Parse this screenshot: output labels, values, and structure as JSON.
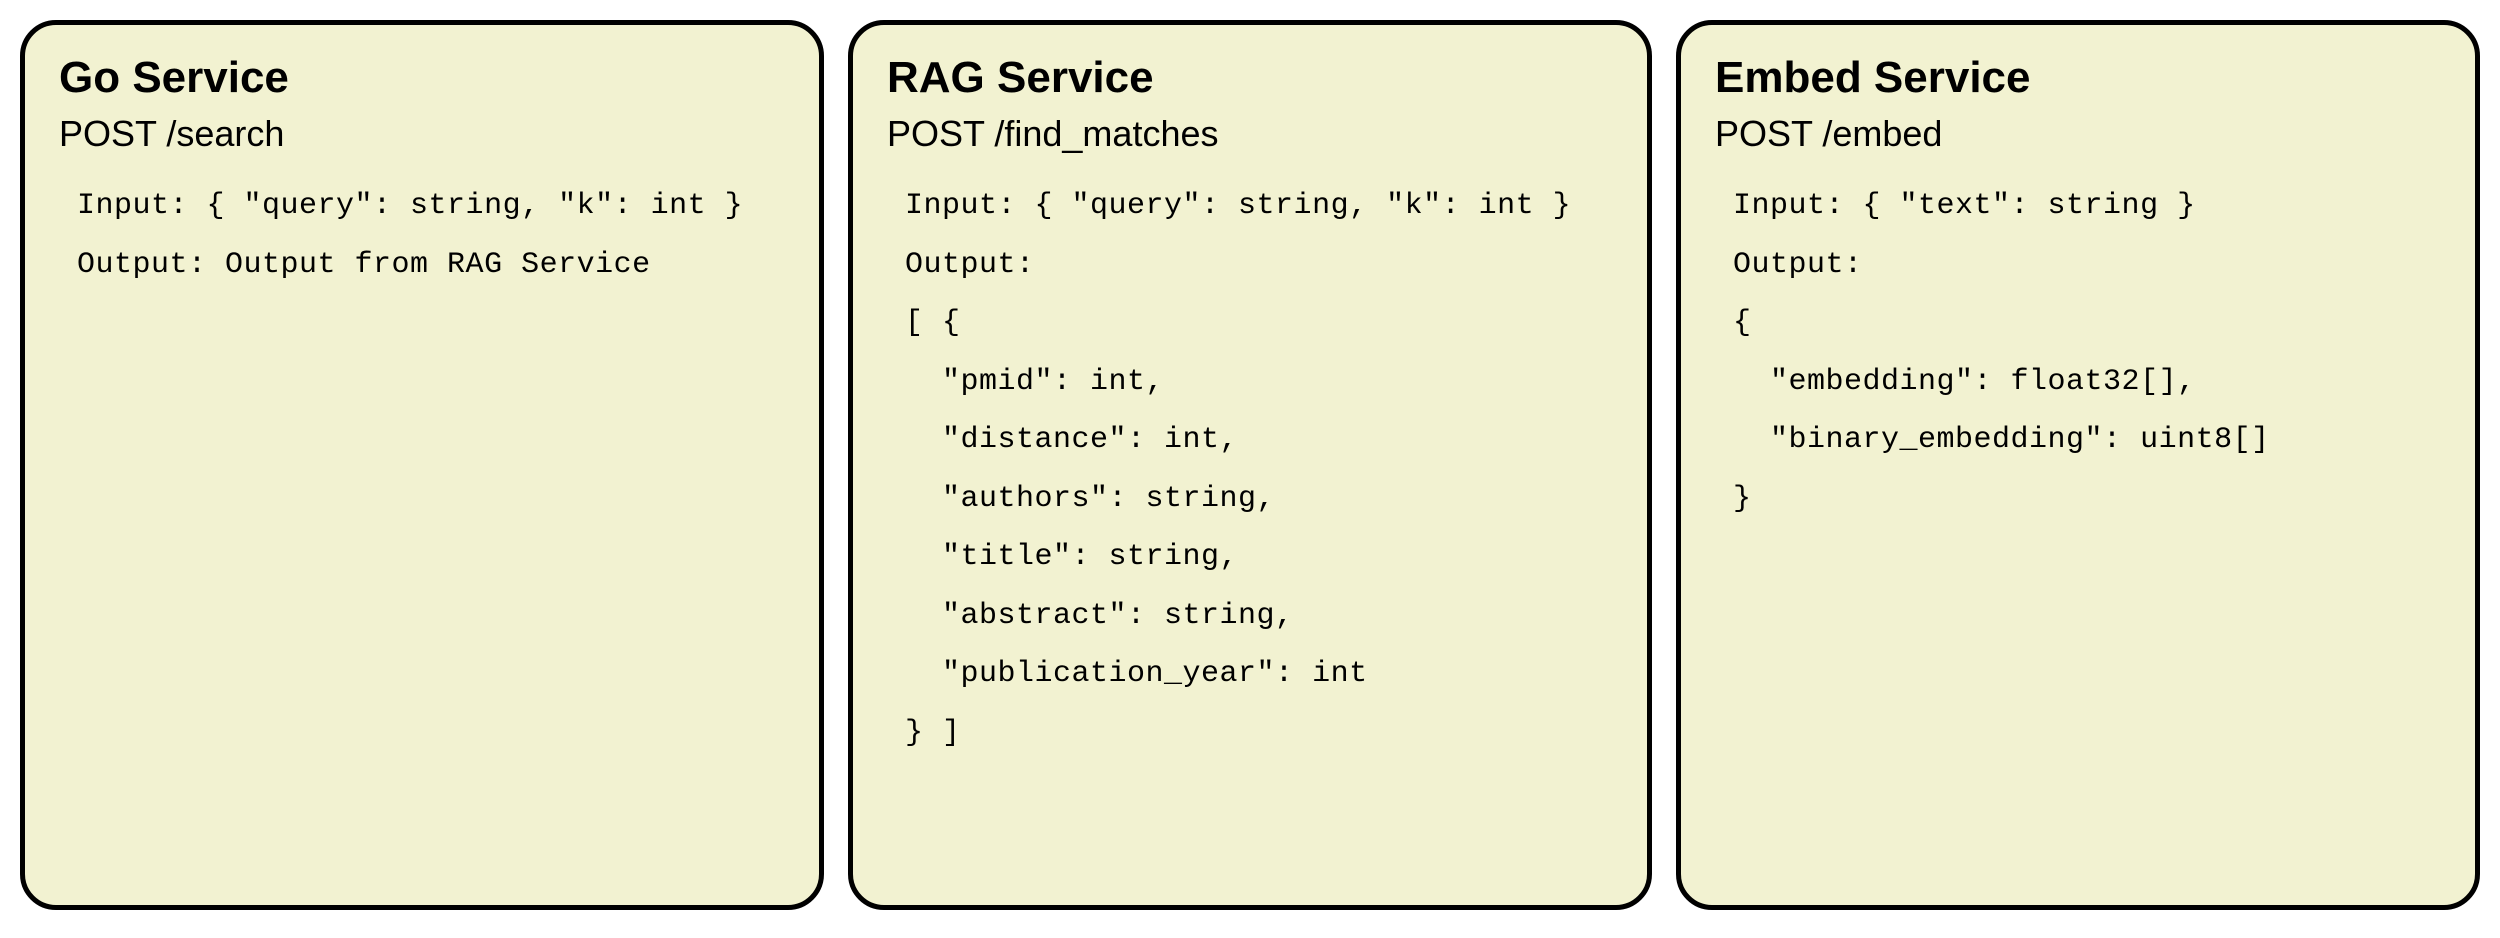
{
  "services": [
    {
      "title": "Go Service",
      "endpoint": "POST /search",
      "body": "Input: { \"query\": string, \"k\": int }\nOutput: Output from RAG Service"
    },
    {
      "title": "RAG Service",
      "endpoint": "POST /find_matches",
      "body": "Input: { \"query\": string, \"k\": int }\nOutput:\n[ {\n  \"pmid\": int,\n  \"distance\": int,\n  \"authors\": string,\n  \"title\": string,\n  \"abstract\": string,\n  \"publication_year\": int\n} ]"
    },
    {
      "title": "Embed Service",
      "endpoint": "POST /embed",
      "body": "Input: { \"text\": string }\nOutput:\n{\n  \"embedding\": float32[],\n  \"binary_embedding\": uint8[]\n}"
    }
  ]
}
